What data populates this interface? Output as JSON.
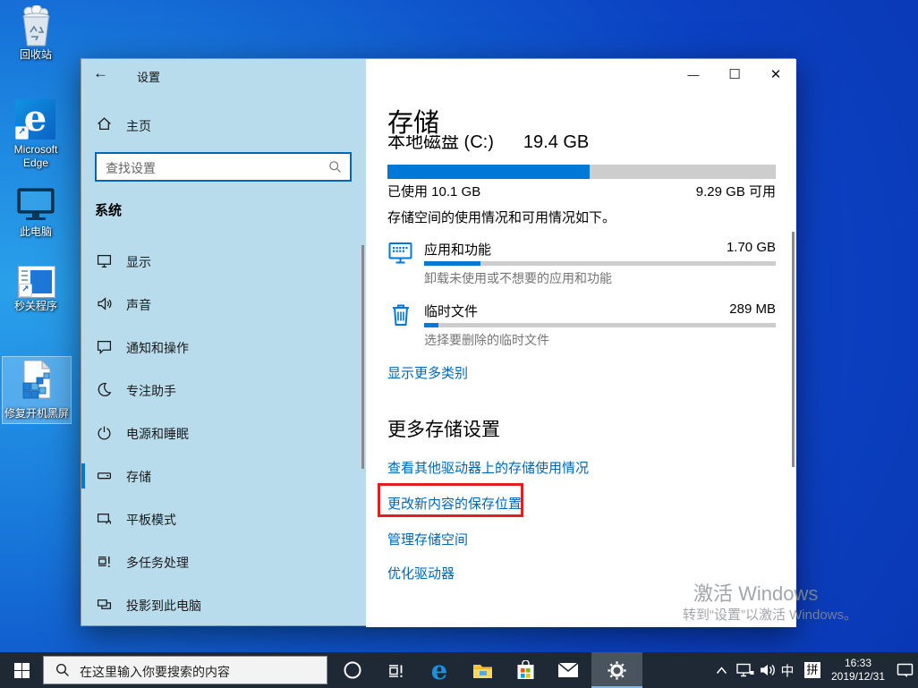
{
  "colors": {
    "accent": "#0078d7",
    "link": "#0066b4",
    "highlight_box": "#e31e1e",
    "sidebar_bg": "#b9dcec",
    "taskbar_bg": "#1e2935"
  },
  "desktop": {
    "icons": [
      {
        "label": "回收站"
      },
      {
        "label_line1": "Microsoft",
        "label_line2": "Edge"
      },
      {
        "label": "此电脑"
      },
      {
        "label": "秒关程序"
      },
      {
        "label": "修复开机黑屏"
      }
    ]
  },
  "window": {
    "title": "设置",
    "sidebar": {
      "home_label": "主页",
      "search_placeholder": "查找设置",
      "section_header": "系统",
      "items": [
        {
          "label": "显示",
          "icon": "display-icon",
          "active": false
        },
        {
          "label": "声音",
          "icon": "sound-icon",
          "active": false
        },
        {
          "label": "通知和操作",
          "icon": "notifications-icon",
          "active": false
        },
        {
          "label": "专注助手",
          "icon": "focus-assist-icon",
          "active": false
        },
        {
          "label": "电源和睡眠",
          "icon": "power-sleep-icon",
          "active": false
        },
        {
          "label": "存储",
          "icon": "storage-icon",
          "active": true
        },
        {
          "label": "平板模式",
          "icon": "tablet-mode-icon",
          "active": false
        },
        {
          "label": "多任务处理",
          "icon": "multitasking-icon",
          "active": false
        },
        {
          "label": "投影到此电脑",
          "icon": "project-icon",
          "active": false
        }
      ]
    },
    "main": {
      "page_title": "存储",
      "drive": {
        "name": "本地磁盘 (C:)",
        "total": "19.4 GB",
        "used_label": "已使用 10.1 GB",
        "free_label": "9.29 GB 可用",
        "used_percent": 52
      },
      "usage_intro": "存储空间的使用情况和可用情况如下。",
      "categories": [
        {
          "title": "应用和功能",
          "value": "1.70 GB",
          "desc": "卸载未使用或不想要的应用和功能",
          "percent": 16,
          "icon": "apps-features-icon"
        },
        {
          "title": "临时文件",
          "value": "289 MB",
          "desc": "选择要删除的临时文件",
          "percent": 4,
          "icon": "temp-files-icon"
        }
      ],
      "show_more_link": "显示更多类别",
      "more_settings_header": "更多存储设置",
      "links": [
        {
          "label": "查看其他驱动器上的存储使用情况",
          "highlighted": false
        },
        {
          "label": "更改新内容的保存位置",
          "highlighted": true
        },
        {
          "label": "管理存储空间",
          "highlighted": false
        },
        {
          "label": "优化驱动器",
          "highlighted": false
        }
      ]
    }
  },
  "watermark": {
    "line1": "激活 Windows",
    "line2": "转到“设置”以激活 Windows。"
  },
  "taskbar": {
    "search_placeholder": "在这里输入你要搜索的内容",
    "ime_lang": "中",
    "ime_mode": "拼",
    "clock": {
      "time": "16:33",
      "date": "2019/12/31"
    }
  }
}
